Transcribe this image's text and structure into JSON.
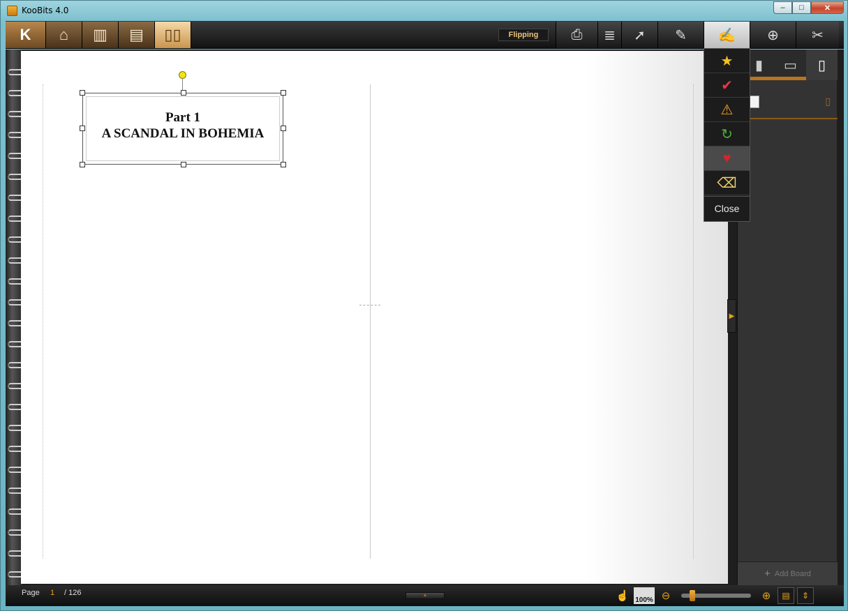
{
  "window": {
    "title": "KooBits 4.0"
  },
  "window_controls": {
    "minimize": "–",
    "maximize": "□",
    "close": "✕"
  },
  "toolbar": {
    "mode_label": "Flipping",
    "left_buttons": [
      "koobits-menu",
      "home",
      "bookshelf",
      "library",
      "reader"
    ],
    "right_buttons": [
      "print",
      "notes",
      "select",
      "highlighter",
      "stamps",
      "add-bookmark",
      "cut"
    ]
  },
  "page": {
    "title_line1": "Part 1",
    "title_line2": "A SCANDAL IN BOHEMIA"
  },
  "stamp_menu": {
    "items": [
      "star-icon",
      "check-icon",
      "warning-icon",
      "refresh-icon",
      "heart-icon",
      "eraser-icon"
    ],
    "close_label": "Close"
  },
  "side_panel": {
    "tabs": [
      "bookmarks",
      "book-view",
      "notes"
    ],
    "add_board_label": "Add Board"
  },
  "statusbar": {
    "page_label": "Page",
    "current_page": "1",
    "total_pages": "/ 126",
    "zoom_label": "100%"
  }
}
